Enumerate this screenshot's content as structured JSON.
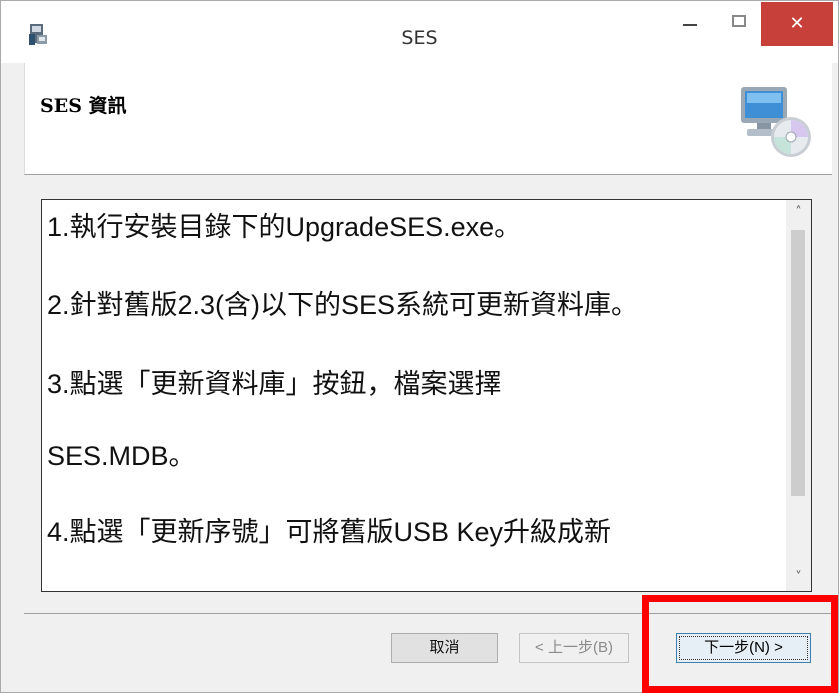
{
  "window": {
    "title": "SES",
    "icons": {
      "app": "installer-icon",
      "minimize": "minimize-icon",
      "maximize": "maximize-icon",
      "close": "close-icon"
    },
    "close_glyph": "✕",
    "close_color": "#c7403a"
  },
  "header": {
    "title": "SES 資訊",
    "graphic": "computer-cd-icon"
  },
  "content": {
    "lines": [
      "1.執行安裝目錄下的UpgradeSES.exe。",
      "2.針對舊版2.3(含)以下的SES系統可更新資料庫。",
      "3.點選「更新資料庫」按鈕，檔案選擇",
      "SES.MDB。",
      "4.點選「更新序號」可將舊版USB Key升級成新"
    ],
    "scroll_up_glyph": "˄",
    "scroll_down_glyph": "˅"
  },
  "buttons": {
    "cancel": "取消",
    "back": "< 上一步(B)",
    "next": "下一步(N) >"
  },
  "highlight": {
    "target": "next-button",
    "color": "#ff0000"
  }
}
